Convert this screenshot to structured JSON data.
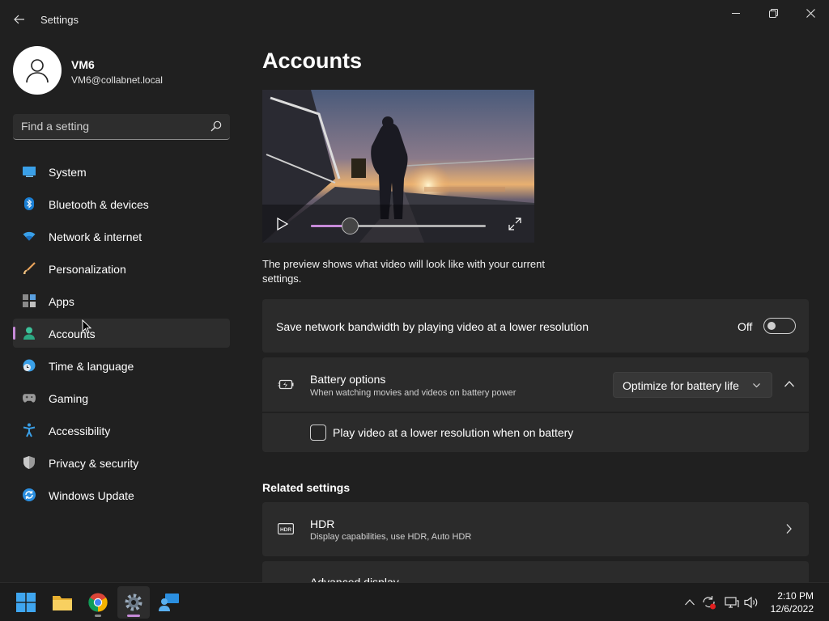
{
  "window": {
    "title": "Settings",
    "controls": {
      "minimize": "minimize",
      "restore": "restore",
      "close": "close"
    }
  },
  "profile": {
    "name": "VM6",
    "email": "VM6@collabnet.local"
  },
  "search": {
    "placeholder": "Find a setting"
  },
  "sidebar": {
    "items": [
      {
        "label": "System",
        "icon": "system-icon"
      },
      {
        "label": "Bluetooth & devices",
        "icon": "bluetooth-icon"
      },
      {
        "label": "Network & internet",
        "icon": "wifi-icon"
      },
      {
        "label": "Personalization",
        "icon": "brush-icon"
      },
      {
        "label": "Apps",
        "icon": "apps-icon"
      },
      {
        "label": "Accounts",
        "icon": "accounts-icon",
        "selected": true
      },
      {
        "label": "Time & language",
        "icon": "clock-globe-icon"
      },
      {
        "label": "Gaming",
        "icon": "gamepad-icon"
      },
      {
        "label": "Accessibility",
        "icon": "accessibility-icon"
      },
      {
        "label": "Privacy & security",
        "icon": "shield-icon"
      },
      {
        "label": "Windows Update",
        "icon": "update-icon"
      }
    ]
  },
  "main": {
    "title": "Accounts",
    "video": {
      "progress": 0.22
    },
    "preview_text": "The preview shows what video will look like with your current settings.",
    "bandwidth": {
      "label": "Save network bandwidth by playing video at a lower resolution",
      "state_label": "Off",
      "on": false
    },
    "battery": {
      "label": "Battery options",
      "description": "When watching movies and videos on battery power",
      "dropdown_value": "Optimize for battery life",
      "expanded": true,
      "checkbox_label": "Play video at a lower resolution when on battery",
      "checked": false
    },
    "related": {
      "heading": "Related settings",
      "items": [
        {
          "label": "HDR",
          "description": "Display capabilities, use HDR, Auto HDR"
        },
        {
          "label": "Advanced display",
          "description": ""
        }
      ]
    }
  },
  "taskbar": {
    "apps": [
      "start",
      "file-explorer",
      "chrome",
      "settings",
      "remote-desktop"
    ],
    "clock": {
      "time": "2:10 PM",
      "date": "12/6/2022"
    }
  },
  "colors": {
    "accent": "#c68ad8",
    "background": "#202020",
    "card": "#2b2b2b"
  }
}
